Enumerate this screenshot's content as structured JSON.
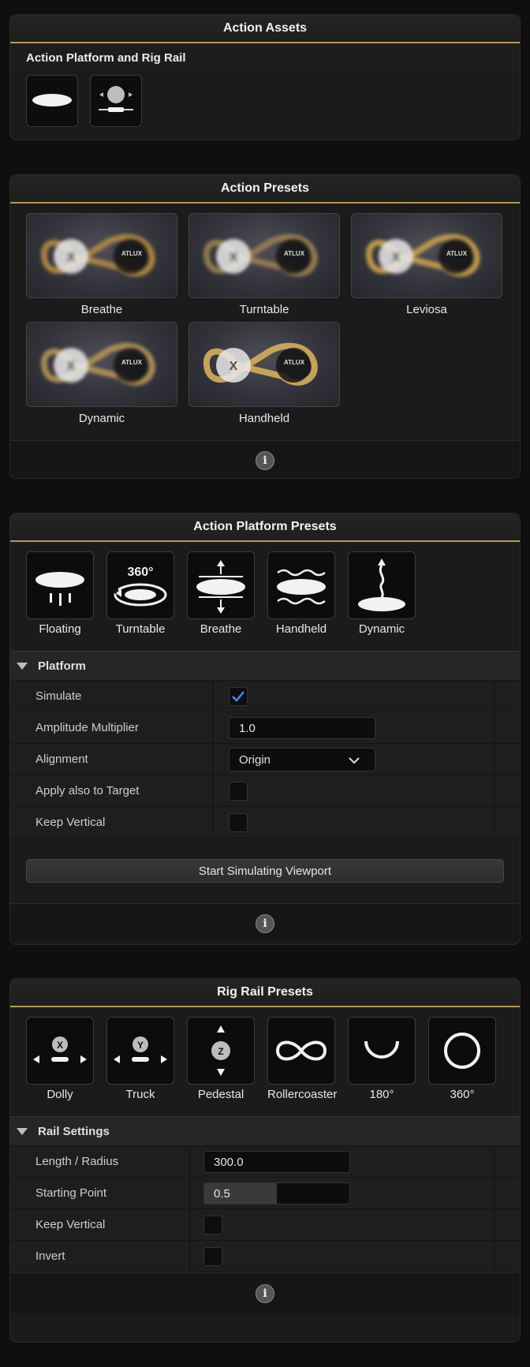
{
  "action_assets": {
    "title": "Action Assets",
    "subtitle": "Action Platform and Rig Rail",
    "buttons": [
      {
        "name": "platform-asset-button",
        "icon": "platform-disc-icon"
      },
      {
        "name": "rig-rail-asset-button",
        "icon": "rig-rail-icon"
      }
    ]
  },
  "action_presets": {
    "title": "Action Presets",
    "items": [
      {
        "label": "Breathe"
      },
      {
        "label": "Turntable"
      },
      {
        "label": "Leviosa"
      },
      {
        "label": "Dynamic"
      },
      {
        "label": "Handheld"
      }
    ],
    "thumb_text": "ATLUX"
  },
  "platform_presets": {
    "title": "Action Platform Presets",
    "items": [
      {
        "label": "Floating",
        "icon": "floating-icon"
      },
      {
        "label": "Turntable",
        "icon": "turntable-360-icon",
        "badge": "360°"
      },
      {
        "label": "Breathe",
        "icon": "breathe-icon"
      },
      {
        "label": "Handheld",
        "icon": "handheld-icon"
      },
      {
        "label": "Dynamic",
        "icon": "dynamic-icon"
      }
    ],
    "section": "Platform",
    "props": {
      "simulate_label": "Simulate",
      "simulate_checked": true,
      "amplitude_label": "Amplitude Multiplier",
      "amplitude_value": "1.0",
      "alignment_label": "Alignment",
      "alignment_value": "Origin",
      "apply_target_label": "Apply also to Target",
      "apply_target_checked": false,
      "keep_vertical_label": "Keep Vertical",
      "keep_vertical_checked": false
    },
    "simulate_button": "Start Simulating Viewport"
  },
  "rig_rail": {
    "title": "Rig Rail Presets",
    "items": [
      {
        "label": "Dolly",
        "icon": "dolly-icon",
        "axis": "X"
      },
      {
        "label": "Truck",
        "icon": "truck-icon",
        "axis": "Y"
      },
      {
        "label": "Pedestal",
        "icon": "pedestal-icon",
        "axis": "Z"
      },
      {
        "label": "Rollercoaster",
        "icon": "rollercoaster-icon"
      },
      {
        "label": "180°",
        "icon": "arc-180-icon"
      },
      {
        "label": "360°",
        "icon": "circle-360-icon"
      }
    ],
    "section": "Rail Settings",
    "props": {
      "length_label": "Length / Radius",
      "length_value": "300.0",
      "start_label": "Starting Point",
      "start_value": "0.5",
      "start_fraction": 0.5,
      "keep_vertical_label": "Keep Vertical",
      "keep_vertical_checked": false,
      "invert_label": "Invert",
      "invert_checked": false
    }
  },
  "info_glyph": "i",
  "colors": {
    "accent_gold": "#b89a55",
    "check_blue": "#3d8bff"
  }
}
